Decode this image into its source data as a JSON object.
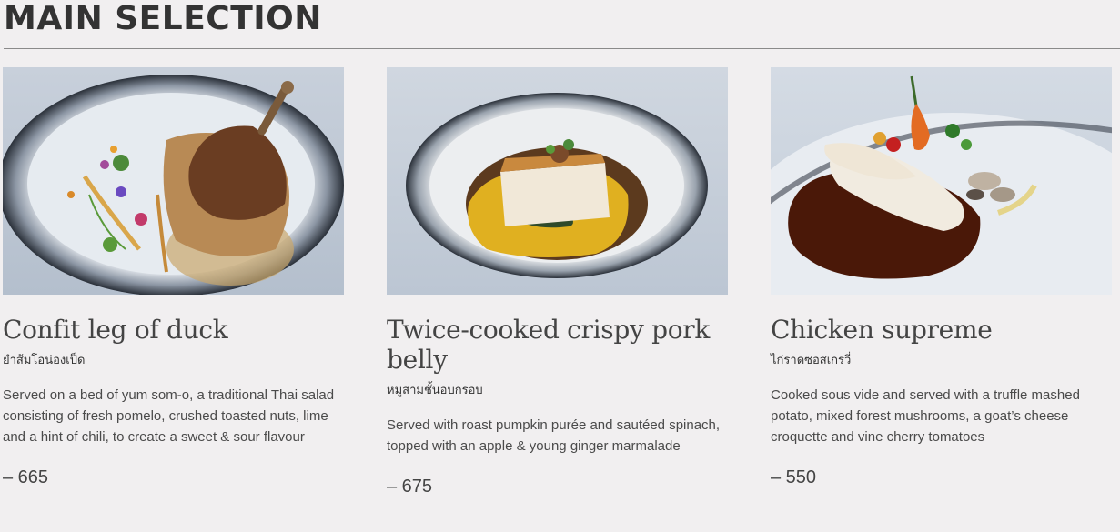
{
  "section": {
    "title": "MAIN SELECTION"
  },
  "dishes": [
    {
      "name": "Confit leg of duck",
      "thai_name": "ยำส้มโอน่องเป็ด",
      "description": "Served on a bed of yum som-o, a traditional Thai salad consisting of fresh pomelo, crushed toasted nuts, lime and a hint of chili, to create a sweet & sour flavour",
      "price": "– 665"
    },
    {
      "name": "Twice-cooked crispy pork belly",
      "thai_name": "หมูสามชั้นอบกรอบ",
      "description": "Served with roast pumpkin purée and sautéed spinach, topped with an apple & young ginger marmalade",
      "price": "– 675"
    },
    {
      "name": "Chicken supreme",
      "thai_name": "ไก่ราดซอสเกรวี่",
      "description": "Cooked sous vide and served with a truffle mashed potato, mixed forest mushrooms,  a goat’s cheese croquette and vine cherry tomatoes",
      "price": "– 550"
    }
  ]
}
